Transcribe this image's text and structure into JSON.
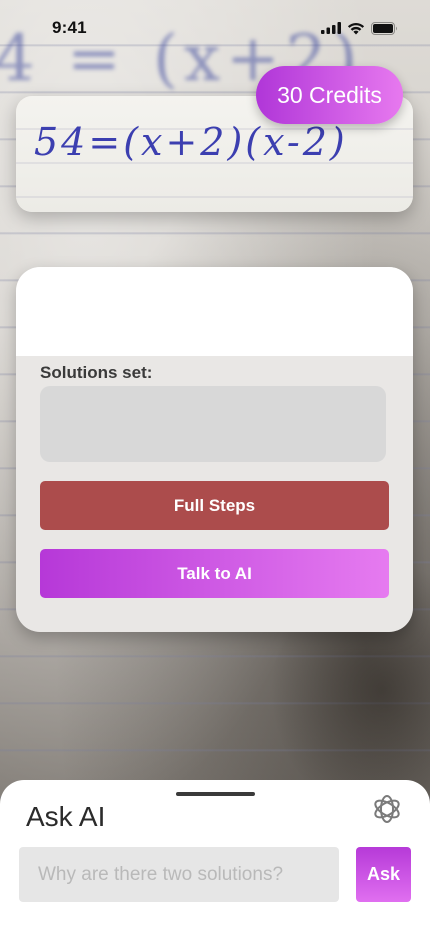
{
  "status_bar": {
    "time": "9:41"
  },
  "camera": {
    "background_equation": "4 = (x+2)"
  },
  "capture": {
    "equation": "54=(x+2)(x-2)"
  },
  "credits": {
    "label": "30 Credits"
  },
  "result": {
    "solutions_label": "Solutions set:",
    "solutions_value": "",
    "full_steps_label": "Full Steps",
    "talk_ai_label": "Talk to AI"
  },
  "ask_ai": {
    "title": "Ask AI",
    "input_value": "",
    "input_placeholder": "Why are there two solutions?",
    "ask_label": "Ask",
    "logo_icon": "openai-logo-icon"
  },
  "colors": {
    "accent_start": "#b036d8",
    "accent_end": "#e779ef",
    "steps_button": "#ac4c4c",
    "panel_bg": "#e9e7e5"
  }
}
